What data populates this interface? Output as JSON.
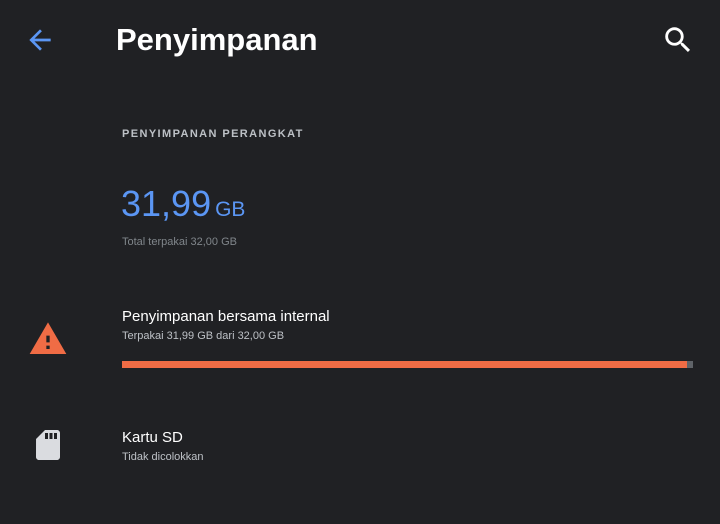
{
  "header": {
    "title": "Penyimpanan",
    "back_icon": "arrow-back-icon",
    "search_icon": "search-icon"
  },
  "device_storage": {
    "section_label": "PENYIMPANAN PERANGKAT",
    "used_value": "31,99",
    "used_unit": "GB",
    "total_text": "Total terpakai 32,00 GB"
  },
  "internal_storage": {
    "icon": "warning-icon",
    "title": "Penyimpanan bersama internal",
    "subtitle": "Terpakai 31,99 GB dari 32,00 GB",
    "used_fraction": 0.99
  },
  "sd_card": {
    "icon": "sd-card-icon",
    "title": "Kartu SD",
    "subtitle": "Tidak dicolokkan"
  },
  "colors": {
    "background": "#202124",
    "accent": "#5b96f4",
    "warning": "#f06c45",
    "progress_track": "#5f6368"
  }
}
